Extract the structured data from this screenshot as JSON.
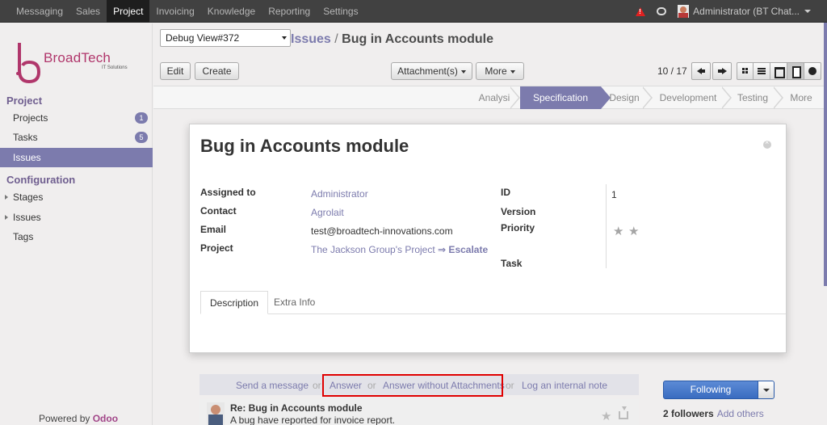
{
  "topbar": {
    "menu": [
      "Messaging",
      "Sales",
      "Project",
      "Invoicing",
      "Knowledge",
      "Reporting",
      "Settings"
    ],
    "active_menu": "Project",
    "user": "Administrator (BT  Chat..."
  },
  "sidebar": {
    "logo_text": "BroadTech",
    "logo_sub": "IT Solutions",
    "section1": "Project",
    "items": [
      {
        "label": "Projects",
        "badge": "1"
      },
      {
        "label": "Tasks",
        "badge": "5"
      },
      {
        "label": "Issues",
        "badge": ""
      }
    ],
    "section2": "Configuration",
    "config_items": [
      "Stages",
      "Issues",
      "Tags"
    ],
    "powered_by": "Powered by ",
    "powered_brand": "Odoo"
  },
  "header": {
    "debug_select": "Debug View#372",
    "breadcrumb_link": "Issues",
    "breadcrumb_sep": " / ",
    "breadcrumb_current": "Bug in Accounts module",
    "edit_label": "Edit",
    "create_label": "Create",
    "attachments_label": "Attachment(s)",
    "more_label": "More",
    "pager": "10 / 17"
  },
  "stages": [
    "Analysis",
    "Specification",
    "Design",
    "Development",
    "Testing",
    "More"
  ],
  "active_stage": "Specification",
  "form": {
    "title": "Bug in Accounts module",
    "assigned_to_label": "Assigned to",
    "assigned_to": "Administrator",
    "contact_label": "Contact",
    "contact": "Agrolait",
    "email_label": "Email",
    "email": "test@broadtech-innovations.com",
    "project_label": "Project",
    "project": "The Jackson Group's Project",
    "escalate": "⇒ Escalate",
    "id_label": "ID",
    "id_value": "1",
    "version_label": "Version",
    "priority_label": "Priority",
    "task_label": "Task",
    "priority_stars": 0,
    "tabs": [
      "Description",
      "Extra Info"
    ]
  },
  "chatter": {
    "send_message": "Send a message",
    "or": "or",
    "answer": "Answer",
    "answer_no_attach": "Answer without Attachments",
    "log_note": "Log an internal note",
    "following": "Following",
    "followers": "2 followers",
    "add_others": "Add others",
    "message_title": "Re: Bug in Accounts module",
    "message_body": "A bug have reported for invoice report."
  },
  "colors": {
    "accent": "#7c7bad",
    "topbar": "#414141",
    "highlight_box": "#e00000"
  }
}
